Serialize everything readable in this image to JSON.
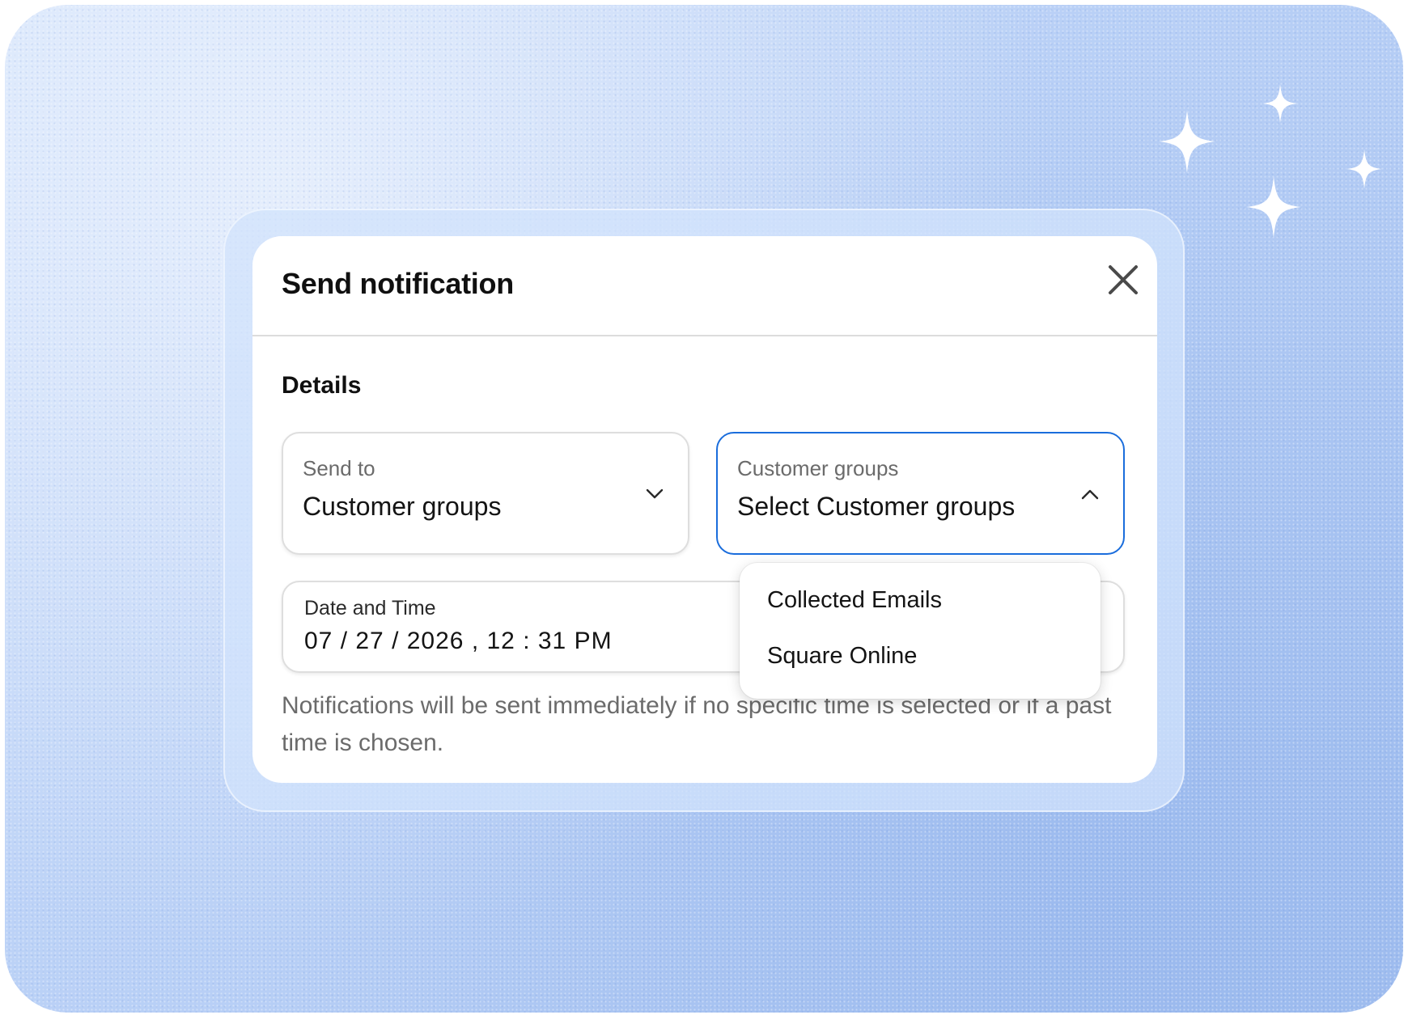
{
  "dialog": {
    "title": "Send notification",
    "close_icon": "close-icon"
  },
  "details": {
    "section_title": "Details",
    "send_to": {
      "label": "Send to",
      "value": "Customer groups",
      "icon": "chevron-down-icon"
    },
    "customer_groups": {
      "label": "Customer groups",
      "placeholder": "Select Customer groups",
      "icon": "chevron-up-icon",
      "options": [
        "Collected Emails",
        "Square Online"
      ]
    },
    "date_time": {
      "label": "Date and Time",
      "value": "07 / 27 / 2026 , 12 : 31  PM"
    },
    "helper_text": "Notifications will be sent immediately if no specific time is selected or if a past time is chosen."
  },
  "colors": {
    "accent": "#1a6ddc",
    "background": "#b9d0f6"
  },
  "decor": [
    "sparkle-icon",
    "sparkle-icon",
    "sparkle-icon",
    "sparkle-icon"
  ]
}
